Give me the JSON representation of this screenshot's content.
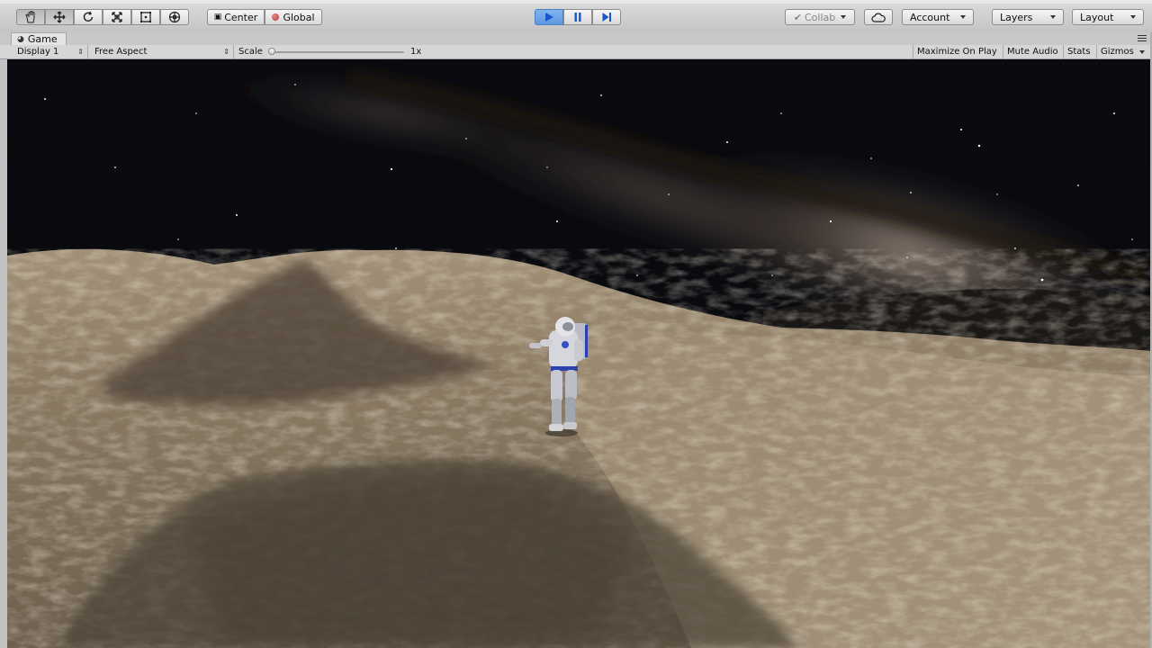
{
  "toolbar": {
    "tools": [
      {
        "name": "hand-tool",
        "icon": "hand-icon",
        "active": true
      },
      {
        "name": "move-tool",
        "icon": "move-arrows-icon",
        "active": true
      },
      {
        "name": "rotate-tool",
        "icon": "rotate-icon",
        "active": false
      },
      {
        "name": "scale-tool",
        "icon": "scale-icon",
        "active": false
      },
      {
        "name": "rect-tool",
        "icon": "rect-transform-icon",
        "active": false
      },
      {
        "name": "transform-tool",
        "icon": "transform-icon",
        "active": false
      }
    ],
    "pivot_label": "Center",
    "space_label": "Global",
    "play": {
      "play_icon": "play-icon",
      "pause_icon": "pause-icon",
      "step_icon": "step-icon",
      "playing": true,
      "accent": "#5f98e0"
    },
    "collab_label": "Collab",
    "cloud_icon": "cloud-icon",
    "account_label": "Account",
    "layers_label": "Layers",
    "layout_label": "Layout"
  },
  "tab": {
    "title": "Game",
    "icon": "game-controller-icon"
  },
  "game_bar": {
    "display_label": "Display 1",
    "aspect_label": "Free Aspect",
    "scale_label": "Scale",
    "scale_value": "1x",
    "scale_level": 0,
    "maximize_label": "Maximize On Play",
    "mute_label": "Mute Audio",
    "stats_label": "Stats",
    "gizmos_label": "Gizmos"
  }
}
